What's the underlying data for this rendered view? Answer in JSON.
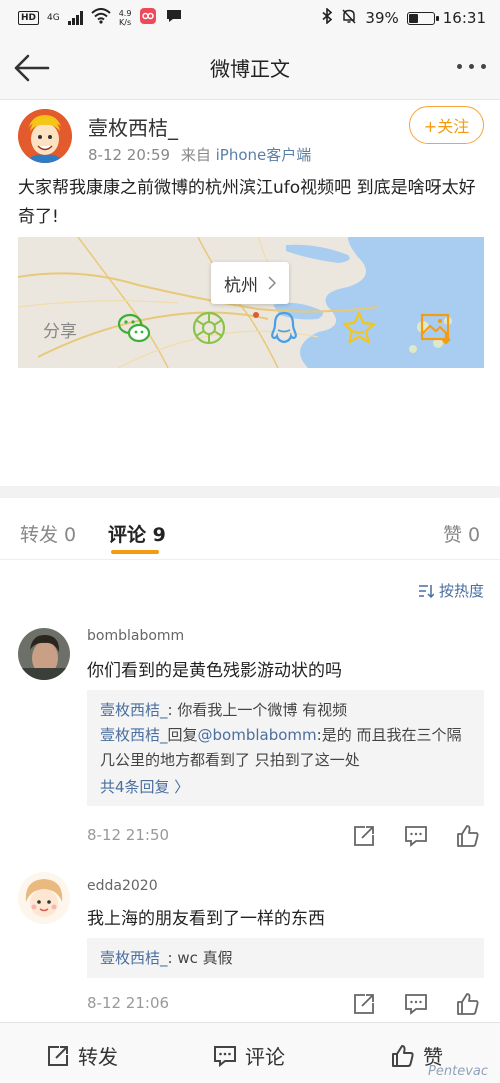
{
  "status_bar": {
    "hd": "HD",
    "net_type": "4G",
    "speed_value": "4.9",
    "speed_unit": "K/s",
    "battery_percent": 0.39,
    "battery_text": "39%",
    "time": "16:31"
  },
  "nav": {
    "title": "微博正文"
  },
  "post": {
    "username": "壹枚西桔_",
    "datetime": "8-12 20:59",
    "source_prefix": "来自",
    "source": "iPhone客户端",
    "follow_label": "+关注",
    "text": "大家帮我康康之前微博的杭州滨江ufo视频吧 到底是啥呀太好奇了!",
    "map_label": "杭州"
  },
  "share": {
    "label": "分享"
  },
  "tabs": [
    {
      "label": "转发 0"
    },
    {
      "label": "评论 9"
    },
    {
      "label": "赞 0"
    }
  ],
  "sort_label": "按热度",
  "comments": [
    {
      "name": "bomblabomm",
      "text": "你们看到的是黄色残影游动状的吗",
      "reply1_name": "壹枚西桔_",
      "reply1_text": ": 你看我上一个微博 有视频",
      "reply2_name": "壹枚西桔_",
      "reply2_mid": "回复",
      "reply2_at": "@bomblabomm",
      "reply2_text": ":是的 而且我在三个隔几公里的地方都看到了 只拍到了这一处",
      "more_replies": "共4条回复 〉",
      "time": "8-12 21:50"
    },
    {
      "name": "edda2020",
      "text": "我上海的朋友看到了一样的东西",
      "reply1_name": "壹枚西桔_",
      "reply1_text": ": wc 真假",
      "time": "8-12 21:06"
    }
  ],
  "bottom_bar": {
    "repost": "转发",
    "comment": "评论",
    "like": "赞"
  },
  "watermark": "Pentevac",
  "colors": {
    "accent": "#f39c12",
    "link": "#4a6fa0",
    "wechat": "#3cb035",
    "moments": "#8bc34a",
    "qq": "#4a9fe8",
    "star": "#f5c518"
  }
}
